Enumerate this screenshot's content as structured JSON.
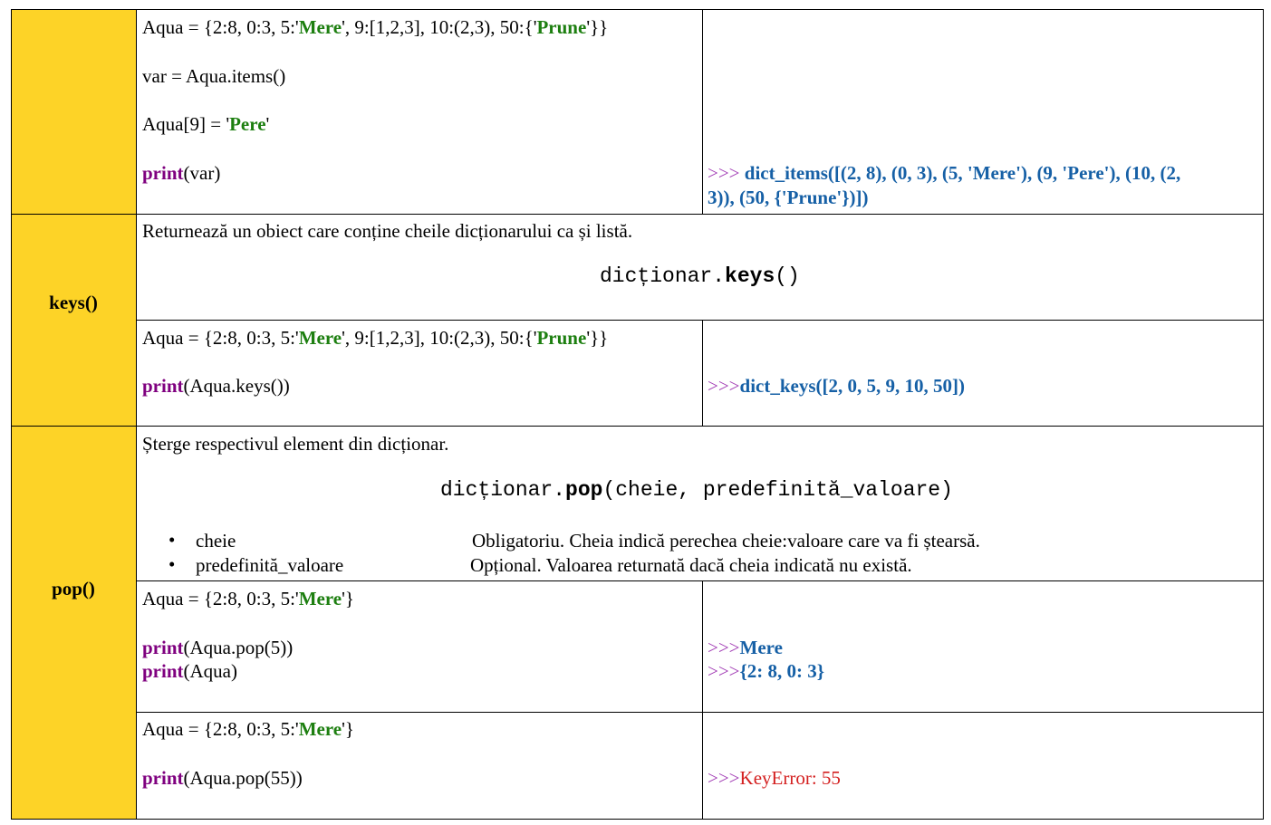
{
  "items_example": {
    "line1": {
      "a": "Aqua = {2:8, 0:3, 5:'",
      "s1": "Mere",
      "b": "', 9:[1,2,3], 10:(2,3), 50:{'",
      "s2": "Prune",
      "c": "'}}"
    },
    "line2": "var = Aqua.items()",
    "line3": {
      "a": "Aqua[9] = '",
      "s1": "Pere",
      "b": "'"
    },
    "line4": {
      "kw": "print",
      "rest": "(var)"
    },
    "output_prompt": ">>> ",
    "output_line1": "dict_items([(2, 8), (0, 3), (5, 'Mere'), (9, 'Pere'), (10, (2,",
    "output_line2": "3)), (50, {'Prune'})])"
  },
  "keys": {
    "name": "keys()",
    "description": "Returnează un obiect care conține cheile dicționarului ca și listă.",
    "syntax": {
      "obj": "dicționar.",
      "method": "keys",
      "args": "()"
    },
    "example": {
      "line1": {
        "a": "Aqua = {2:8, 0:3, 5:'",
        "s1": "Mere",
        "b": "', 9:[1,2,3], 10:(2,3), 50:{'",
        "s2": "Prune",
        "c": "'}}"
      },
      "line2": {
        "kw": "print",
        "rest": "(Aqua.keys())"
      },
      "output_prompt": ">>>",
      "output": "dict_keys([2, 0, 5, 9, 10, 50])"
    }
  },
  "pop": {
    "name": "pop()",
    "description": "Șterge respectivul element din dicționar.",
    "syntax": {
      "obj": "dicționar.",
      "method": "pop",
      "args": "(cheie, predefinită_valoare)"
    },
    "params": [
      {
        "name": "cheie",
        "desc": "Obligatoriu. Cheia indică perechea cheie:valoare care va fi ștearsă."
      },
      {
        "name": "predefinită_valoare",
        "desc": "Opțional. Valoarea returnată dacă cheia indicată nu există."
      }
    ],
    "bullet": "•",
    "example1": {
      "line1": {
        "a": "Aqua = {2:8, 0:3, 5:'",
        "s1": "Mere",
        "b": "'}"
      },
      "line2": {
        "kw": "print",
        "rest": "(Aqua.pop(5))"
      },
      "line3": {
        "kw": "print",
        "rest": "(Aqua)"
      },
      "output_prompt": ">>>",
      "output1": "Mere",
      "output2": "{2: 8, 0: 3}"
    },
    "example2": {
      "line1": {
        "a": "Aqua = {2:8, 0:3, 5:'",
        "s1": "Mere",
        "b": "'}"
      },
      "line2": {
        "kw": "print",
        "rest": "(Aqua.pop(55))"
      },
      "output_prompt": ">>>",
      "output": "KeyError: 55"
    }
  }
}
